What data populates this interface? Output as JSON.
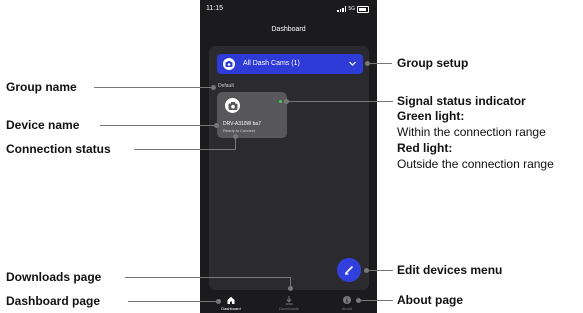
{
  "status_bar": {
    "time": "11:15",
    "network": "5G"
  },
  "app": {
    "title": "Dashboard"
  },
  "group_selector": {
    "label": "All Dash Cams (1)"
  },
  "group": {
    "name": "Default"
  },
  "device": {
    "name": "DRV-A310W ba7",
    "status": "Ready to Connect"
  },
  "tabs": [
    {
      "label": "Dashboard",
      "icon": "home-icon",
      "active": true
    },
    {
      "label": "Downloads",
      "icon": "download-icon",
      "active": false
    },
    {
      "label": "About",
      "icon": "info-icon",
      "active": false
    }
  ],
  "callouts": {
    "group_name": "Group name",
    "device_name": "Device name",
    "connection_status": "Connection status",
    "downloads_page": "Downloads page",
    "dashboard_page": "Dashboard page",
    "group_setup": "Group setup",
    "signal_status": "Signal status indicator",
    "green_light_title": "Green light:",
    "green_light_desc": "Within the connection range",
    "red_light_title": "Red light:",
    "red_light_desc": "Outside the connection range",
    "edit_devices_menu": "Edit devices menu",
    "about_page": "About page"
  },
  "colors": {
    "accent": "#3140dc",
    "signal_green": "#3ccf4e",
    "phone_bg": "#1b1b1d",
    "panel_bg": "#2b2b2f",
    "card_bg": "#58585c"
  }
}
